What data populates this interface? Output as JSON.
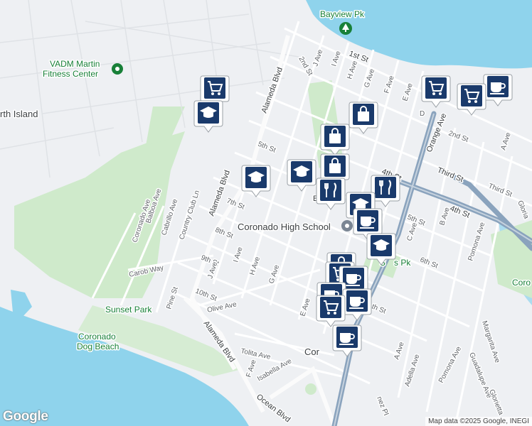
{
  "map": {
    "places": {
      "bayview_pk": "Bayview Pk",
      "vadm_line1": "VADM Martin",
      "vadm_line2": "Fitness Center",
      "north_island": "rth Island",
      "coronado_high": "Coronado High School",
      "sunset_park": "Sunset Park",
      "dog_beach_1": "Coronado",
      "dog_beach_2": "Dog Beach",
      "spreckels": "S",
      "spreckels_2": "s Pk",
      "coronado_edge": "Coro",
      "cor_town": "Cor",
      "e_partial": "E"
    },
    "streets": {
      "first_st": "1st St",
      "second_st": "2nd St",
      "second_st_e": "2nd St",
      "third_st": "Third St",
      "third_st_e": "Third St",
      "fourth_st": "4th St",
      "fourth_st_e": "4th St",
      "fifth_st": "5th St",
      "fifth_st_e": "5th St",
      "sixth_st": "6th St",
      "seventh_st": "7th St",
      "eighth_st": "8th St",
      "ninth_st": "9th St",
      "tenth_st": "10th St",
      "tenth_st_e": "th St",
      "alameda_blvd_n": "Alameda Blvd",
      "alameda_blvd_m": "Alameda Blvd",
      "alameda_blvd_s": "Alameda Blvd",
      "orange_ave": "Orange Ave",
      "j_ave_n": "J Ave",
      "j_ave_s": "J Ave",
      "i_ave_n": "I Ave",
      "i_ave_s": "I Ave",
      "h_ave_n": "H Ave",
      "h_ave_s": "H Ave",
      "g_ave_n": "G Ave",
      "g_ave_s": "G Ave",
      "f_ave_n": "F Ave",
      "f_ave_s": "F Ave",
      "e_ave_n": "E Ave",
      "e_ave_s": "E Ave",
      "d_partial": "D",
      "c_ave": "C Ave",
      "b_ave": "B Ave",
      "a_ave_n": "A Ave",
      "a_ave_s": "A Ave",
      "adella_ave": "Adella Ave",
      "pomona_ave_e": "Pomona Ave",
      "pomona_ave_s": "Pomona Ave",
      "margarita_ave": "Margarita Ave",
      "guadalupe_ave": "Guadalupe Ave",
      "glorietta_s": "Glorietta",
      "glorietta_e": "Gloria",
      "coronado_ave": "Coronado Ave",
      "balboa_ave": "Balboa Ave",
      "cabrillo_ave": "Cabrillo Ave",
      "country_club_ln": "Country Club Ln",
      "carob_way": "Carob Way",
      "pine_st": "Pine St",
      "olive_ave": "Olive Ave",
      "tolita_ave": "Tolita Ave",
      "isabella_ave": "Isabella Ave",
      "ocean_blvd": "Ocean Blvd",
      "nez_pl": "nez Pl"
    },
    "markers": [
      {
        "icon": "shopping-cart-icon",
        "category": "grocery"
      },
      {
        "icon": "graduation-cap-icon",
        "category": "school"
      },
      {
        "icon": "shopping-bag-icon",
        "category": "store"
      },
      {
        "icon": "shopping-bag-icon",
        "category": "store"
      },
      {
        "icon": "graduation-cap-icon",
        "category": "school"
      },
      {
        "icon": "graduation-cap-icon",
        "category": "school"
      },
      {
        "icon": "shopping-bag-icon",
        "category": "store"
      },
      {
        "icon": "fork-knife-icon",
        "category": "restaurant"
      },
      {
        "icon": "fork-knife-icon",
        "category": "restaurant"
      },
      {
        "icon": "graduation-cap-icon",
        "category": "school"
      },
      {
        "icon": "coffee-cup-icon",
        "category": "cafe"
      },
      {
        "icon": "graduation-cap-icon",
        "category": "school"
      },
      {
        "icon": "shopping-bag-icon",
        "category": "store"
      },
      {
        "icon": "shopping-cart-icon",
        "category": "grocery"
      },
      {
        "icon": "coffee-cup-icon",
        "category": "cafe"
      },
      {
        "icon": "coffee-cup-icon",
        "category": "cafe"
      },
      {
        "icon": "coffee-cup-icon",
        "category": "cafe"
      },
      {
        "icon": "shopping-cart-icon",
        "category": "grocery"
      },
      {
        "icon": "shopping-cart-icon",
        "category": "grocery"
      },
      {
        "icon": "coffee-cup-icon",
        "category": "cafe"
      },
      {
        "icon": "shopping-cart-icon",
        "category": "grocery"
      },
      {
        "icon": "coffee-cup-icon",
        "category": "cafe"
      }
    ],
    "colors": {
      "water": "#8fd3ec",
      "land": "#eef0f3",
      "park": "#c5e8c5",
      "road": "#ffffff",
      "highway": "#8aa3bd",
      "marker": "#1a3a6b"
    }
  },
  "footer": {
    "google_logo": "Google",
    "attribution": "Map data ©2025 Google, INEGI"
  }
}
